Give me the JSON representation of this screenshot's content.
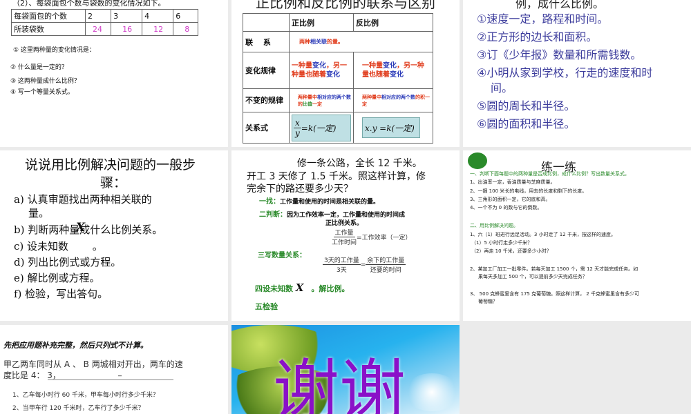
{
  "slide1": {
    "heading": "（2）、每袋面包个数与袋数的变化情况如下。",
    "row1_label": "每袋面包的个数",
    "row1": [
      "2",
      "3",
      "4",
      "6"
    ],
    "row2_label": "所装袋数",
    "row2": [
      "24",
      "16",
      "12",
      "8"
    ],
    "questions": [
      "① 这里两种量的变化情况是：",
      "② 什么量是一定的？",
      "③ 这两种量成什么比例？",
      "④ 写一个等量关系式。"
    ]
  },
  "slide2": {
    "title": "正比例和反比例的联系与区别",
    "col_headers": [
      "正比例",
      "反比例"
    ],
    "row_labels": [
      "联　 系",
      "变化规律",
      "不变的规律",
      "关系式"
    ],
    "link_a": "两种",
    "link_b": "相关联",
    "link_c": "的量。",
    "change_a": "一种量",
    "change_b": "变化",
    "change_c": "，另一种量也随着",
    "change_d": "变化",
    "direct_a": "两种量中",
    "direct_b": "相对应的两个数",
    "direct_c": "的",
    "direct_d": "比值",
    "direct_e": "一定",
    "inverse_a": "两种量中",
    "inverse_b": "相对应的两个数",
    "inverse_c": "的积一定",
    "formula_direct_num": "x",
    "formula_direct_den": "y",
    "formula_direct_rest": "=k(一定)",
    "formula_inverse": "x.y =k(一定)"
  },
  "slide3": {
    "title": "例，成什么比例。",
    "items": [
      "①速度一定，路程和时间。",
      "②正方形的边长和面积。",
      "③订《少年报》数量和所需钱数。",
      "④小明从家到学校，行走的速度和时",
      "间。",
      "⑤圆的周长和半径。",
      "⑥圆的面积和半径。"
    ]
  },
  "slide4": {
    "title_line1": "说说用比例解决问题的一般步",
    "title_line2": "骤：",
    "steps": [
      "a) 认真审题找出两种相关联的",
      "量。",
      "b) 判断两种量成什么比例关系。",
      "c) 设未知数　　 。",
      "d) 列出比例式或方程。",
      "e) 解比例或方程。",
      "f) 检验，写出答句。"
    ],
    "x_symbol": "X"
  },
  "slide5": {
    "problem_line1": "修一条公路，全长 12 千米。",
    "problem_line2": "开工 3 天修了 1.5 千米。照这样计算，修",
    "problem_line3": "完余下的路还要多少天？",
    "step1_label": "一找：",
    "step1_text": "工作量和使用的时间是相关联的量。",
    "step2_label": "二判断：",
    "step2_text": "因为工作效率一定，工作量和使用的时间成",
    "step2_text2": "正比例关系。",
    "eq1_num": "工作量",
    "eq1_den": "工作时间",
    "eq1_rest": "=工作效率（一定）",
    "step3_label": "三写数量关系：",
    "eq2_lnum": "3天的工作量",
    "eq2_lden": "3天",
    "eq2_eq": "=",
    "eq2_rnum": "余下的工作量",
    "eq2_rden": "还要的时间",
    "step4_a": "四设未知数",
    "step4_x": "X",
    "step4_b": "。解比例。",
    "step5": "五检验"
  },
  "slide6": {
    "title": "练一练",
    "section1": "一、判断下面每题中的两种量是否成比例，成什么比例？写出数量关系式。",
    "s1_items": [
      "1、出油率一定，香油质量与芝麻质量。",
      "2、一捆 100 米长的电线，用去的长度和剩下的长度。",
      "3、三角形的面积一定，它的底和高。",
      "4、一个不为 0 的数与它的倒数。"
    ],
    "section2": "二、用比例解决问题。",
    "s2_items": [
      "1、六（1）班进行远足活动。3 小时走了 12 千米，按这样的速度。",
      "（1）5 小时行走多少千米？",
      "（2）再走 10 千米，还要多少小时？",
      "2、某加工厂加工一批零件。若每天加工 1500 个，需 12 天才能完成任务。如",
      "果每天多加工 500 个，可以提前多少天完成任务？",
      "3、 500 克蜂蜜里含有 175 克葡萄糖。照这样计算， 2 千克蜂蜜里含有多少可",
      "葡萄糖？"
    ]
  },
  "slide7": {
    "title": "先把应用题补充完整，然后只列式不计算。",
    "line1": "甲乙两车同时从 A 、 B 两城相对开出，两车的速",
    "line2": "度比是 4： 3，",
    "blank": "_",
    "q1": "1、乙车每小时行 60 千米，甲车每小时行多少千米？",
    "q2": "2、当甲车行 120 千米时，乙车行了多少千米？"
  },
  "slide8": {
    "text": "谢谢"
  }
}
